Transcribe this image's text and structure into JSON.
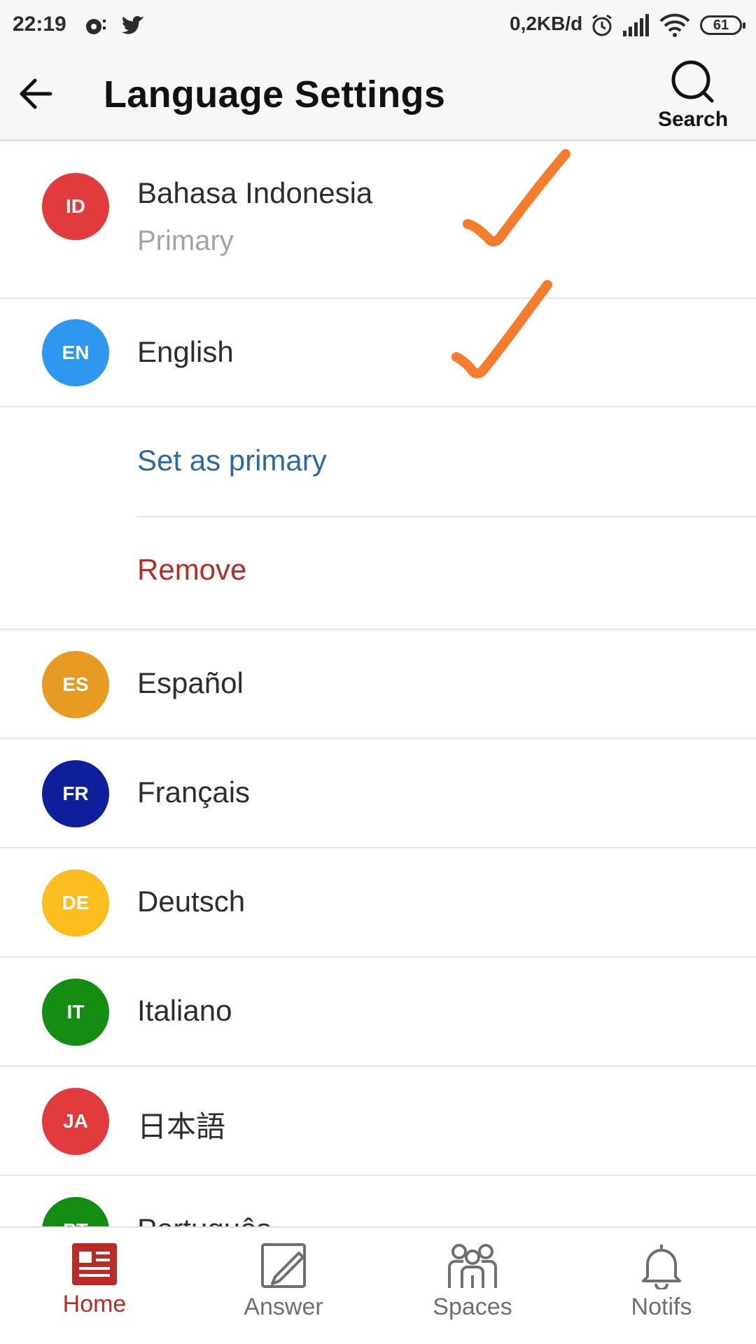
{
  "status_bar": {
    "time": "22:19",
    "network_speed": "0,2KB/d",
    "battery": "61"
  },
  "header": {
    "title": "Language Settings",
    "search_label": "Search"
  },
  "languages": [
    {
      "code": "ID",
      "name": "Bahasa Indonesia",
      "subtitle": "Primary",
      "color": "#e23b3d"
    },
    {
      "code": "EN",
      "name": "English",
      "color": "#2d97ee"
    },
    {
      "code": "ES",
      "name": "Español",
      "color": "#e79b22"
    },
    {
      "code": "FR",
      "name": "Français",
      "color": "#0f1e9a"
    },
    {
      "code": "DE",
      "name": "Deutsch",
      "color": "#fbbd1e"
    },
    {
      "code": "IT",
      "name": "Italiano",
      "color": "#138c12"
    },
    {
      "code": "JA",
      "name": "日本語",
      "color": "#e23b3d"
    },
    {
      "code": "PT",
      "name": "Português",
      "color": "#138c12"
    }
  ],
  "actions": {
    "set_primary": "Set as primary",
    "remove": "Remove"
  },
  "colors": {
    "link_blue": "#2e69a3",
    "remove_red": "#b92b27",
    "active_nav": "#b92b27",
    "inactive_nav": "#6f6f6f",
    "annotation": "#f47c2a"
  },
  "bottom_nav": [
    {
      "label": "Home",
      "icon": "home-news-icon",
      "active": true
    },
    {
      "label": "Answer",
      "icon": "pencil-square-icon",
      "active": false
    },
    {
      "label": "Spaces",
      "icon": "people-group-icon",
      "active": false
    },
    {
      "label": "Notifs",
      "icon": "bell-icon",
      "active": false
    }
  ]
}
